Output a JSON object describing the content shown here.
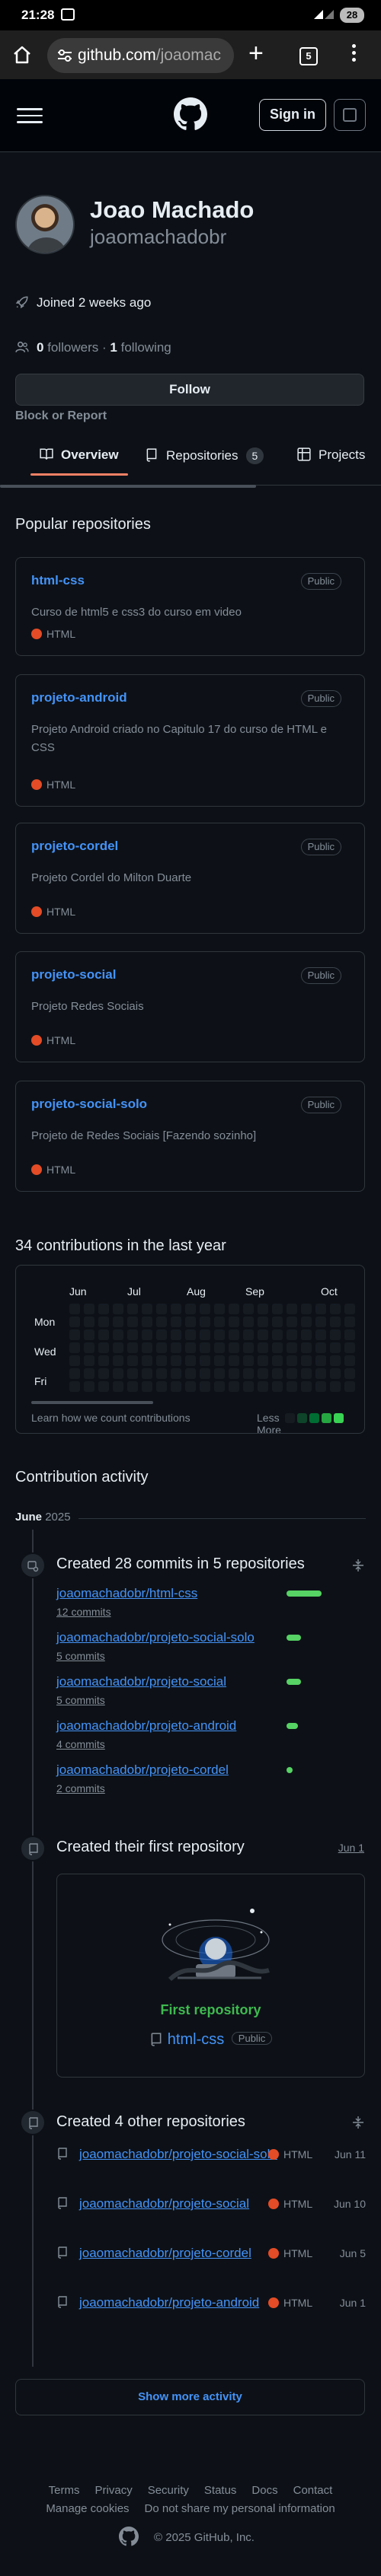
{
  "status_bar": {
    "time": "21:28",
    "battery": "28"
  },
  "browser": {
    "url_host": "github.com",
    "url_path": "/joaomac",
    "tab_count": "5",
    "new_tab": "+"
  },
  "header": {
    "sign_in": "Sign in"
  },
  "profile": {
    "name": "Joao Machado",
    "login": "joaomachadobr",
    "joined": "Joined 2 weeks ago",
    "followers_count": "0",
    "followers_label": "followers",
    "separator": " · ",
    "following_count": "1",
    "following_label": "following",
    "follow_button": "Follow",
    "block_report": "Block or Report"
  },
  "tabs": [
    {
      "label": "Overview"
    },
    {
      "label": "Repositories",
      "count": "5"
    },
    {
      "label": "Projects"
    }
  ],
  "popular": {
    "title": "Popular repositories",
    "repos": [
      {
        "name": "html-css",
        "visibility": "Public",
        "description": "Curso de html5 e css3 do curso em video",
        "language": "HTML"
      },
      {
        "name": "projeto-android",
        "visibility": "Public",
        "description": "Projeto Android criado no Capitulo 17 do curso de HTML e CSS",
        "language": "HTML"
      },
      {
        "name": "projeto-cordel",
        "visibility": "Public",
        "description": "Projeto Cordel do Milton Duarte",
        "language": "HTML"
      },
      {
        "name": "projeto-social",
        "visibility": "Public",
        "description": "Projeto Redes Sociais",
        "language": "HTML"
      },
      {
        "name": "projeto-social-solo",
        "visibility": "Public",
        "description": "Projeto de Redes Sociais [Fazendo sozinho]",
        "language": "HTML"
      }
    ],
    "language_color": "#e34c26"
  },
  "contributions": {
    "title": "34 contributions in the last year",
    "months": [
      "Jun",
      "Jul",
      "Aug",
      "Sep",
      "Oct"
    ],
    "days": [
      "Mon",
      "Wed",
      "Fri"
    ],
    "learn": "Learn how we count contributions",
    "less": "Less",
    "more": "More",
    "level_colors": [
      "#161b22",
      "#0e4429",
      "#006d32",
      "#26a641",
      "#39d353"
    ]
  },
  "activity": {
    "title": "Contribution activity",
    "month": "June",
    "year": "2025",
    "commits": {
      "heading": "Created 28 commits in 5 repositories",
      "items": [
        {
          "repo": "joaomachadobr/html-css",
          "commits": "12 commits",
          "share": 1.0
        },
        {
          "repo": "joaomachadobr/projeto-social-solo",
          "commits": "5 commits",
          "share": 0.42
        },
        {
          "repo": "joaomachadobr/projeto-social",
          "commits": "5 commits",
          "share": 0.42
        },
        {
          "repo": "joaomachadobr/projeto-android",
          "commits": "4 commits",
          "share": 0.33
        },
        {
          "repo": "joaomachadobr/projeto-cordel",
          "commits": "2 commits",
          "share": 0.17
        }
      ]
    },
    "first_repo": {
      "heading": "Created their first repository",
      "date": "Jun 1",
      "label": "First repository",
      "repo": "html-css",
      "visibility": "Public"
    },
    "other_repos": {
      "heading": "Created 4 other repositories",
      "items": [
        {
          "repo": "joaomachadobr/projeto-social-solo",
          "language": "HTML",
          "date": "Jun 11"
        },
        {
          "repo": "joaomachadobr/projeto-social",
          "language": "HTML",
          "date": "Jun 10"
        },
        {
          "repo": "joaomachadobr/projeto-cordel",
          "language": "HTML",
          "date": "Jun 5"
        },
        {
          "repo": "joaomachadobr/projeto-android",
          "language": "HTML",
          "date": "Jun 1"
        }
      ]
    },
    "show_more": "Show more activity"
  },
  "footer": {
    "links_row1": [
      "Terms",
      "Privacy",
      "Security",
      "Status",
      "Docs",
      "Contact"
    ],
    "links_row2": [
      "Manage cookies",
      "Do not share my personal information"
    ],
    "copyright": "© 2025 GitHub, Inc."
  }
}
